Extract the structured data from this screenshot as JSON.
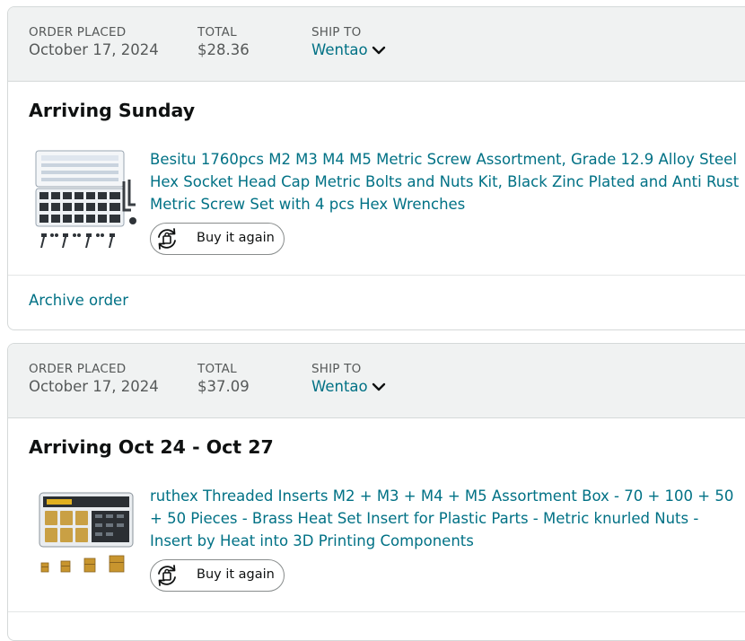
{
  "orders": [
    {
      "order_placed_label": "ORDER PLACED",
      "order_placed": "October 17, 2024",
      "total_label": "TOTAL",
      "total": "$28.36",
      "ship_to_label": "SHIP TO",
      "ship_to": "Wentao",
      "status": "Arriving Sunday",
      "product_title": "Besitu 1760pcs M2 M3 M4 M5 Metric Screw Assortment, Grade 12.9 Alloy Steel Hex Socket Head Cap Metric Bolts and Nuts Kit, Black Zinc Plated and Anti Rust Metric Screw Set with 4 pcs Hex Wrenches",
      "product_image_icon": "screw-assortment-kit-image",
      "buy_again_label": "Buy it again",
      "archive_label": "Archive order"
    },
    {
      "order_placed_label": "ORDER PLACED",
      "order_placed": "October 17, 2024",
      "total_label": "TOTAL",
      "total": "$37.09",
      "ship_to_label": "SHIP TO",
      "ship_to": "Wentao",
      "status": "Arriving Oct 24 - Oct 27",
      "product_title": "ruthex Threaded Inserts M2 + M3 + M4 + M5 Assortment Box - 70 + 100 + 50 + 50 Pieces - Brass Heat Set Insert for Plastic Parts - Metric knurled Nuts - Insert by Heat into 3D Printing Components",
      "product_image_icon": "threaded-inserts-box-image",
      "buy_again_label": "Buy it again"
    }
  ],
  "colors": {
    "link": "#007185",
    "header_bg": "#f0f2f2",
    "muted": "#565959",
    "text": "#0f1111",
    "border": "#d5d9d9"
  }
}
